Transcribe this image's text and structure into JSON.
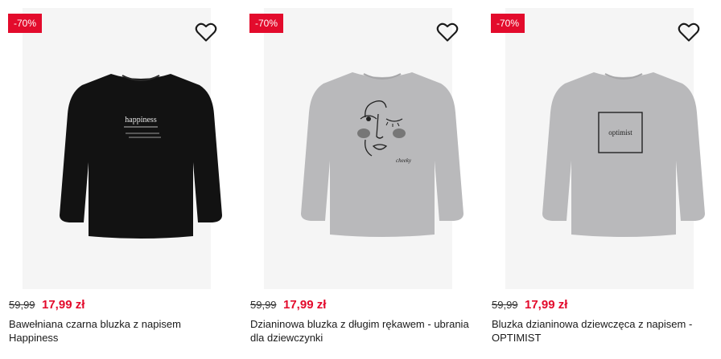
{
  "products": [
    {
      "badge": "-70%",
      "old_price": "59,99",
      "price": "17,99 zł",
      "title": "Bawełniana czarna bluzka z napisem Happiness",
      "print_text": "happiness",
      "shirt_color": "#121212",
      "print_color": "#e8e8e8"
    },
    {
      "badge": "-70%",
      "old_price": "59,99",
      "price": "17,99 zł",
      "title": "Dzianinowa bluzka z długim rękawem - ubrania dla dziewczynki",
      "print_text": "cheeky",
      "shirt_color": "#b9b9bb",
      "print_color": "#222222"
    },
    {
      "badge": "-70%",
      "old_price": "59,99",
      "price": "17,99 zł",
      "title": "Bluzka dzianinowa dziewczęca z napisem - OPTIMIST",
      "print_text": "optimist",
      "shirt_color": "#b9b9bb",
      "print_color": "#222222"
    }
  ],
  "colors": {
    "sale": "#e30b2c",
    "card_bg": "#f5f5f5"
  },
  "icons": {
    "favorite": "heart-outline-icon"
  }
}
